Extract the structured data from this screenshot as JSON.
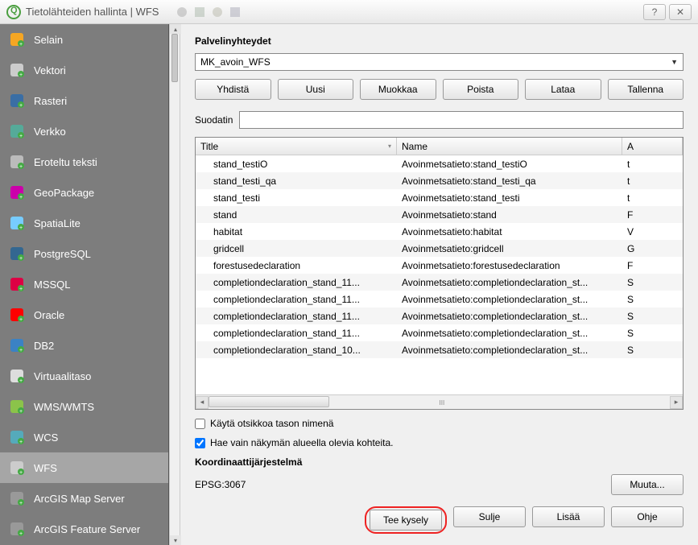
{
  "title": "Tietolähteiden hallinta | WFS",
  "sidebar": {
    "items": [
      {
        "label": "Selain",
        "icon": "folder",
        "color": "#f5a623"
      },
      {
        "label": "Vektori",
        "icon": "vector",
        "color": "#ccc"
      },
      {
        "label": "Rasteri",
        "icon": "raster",
        "color": "#3a6ea5"
      },
      {
        "label": "Verkko",
        "icon": "mesh",
        "color": "#5a9"
      },
      {
        "label": "Eroteltu teksti",
        "icon": "text",
        "color": "#bbb"
      },
      {
        "label": "GeoPackage",
        "icon": "gpkg",
        "color": "#c0a"
      },
      {
        "label": "SpatiaLite",
        "icon": "spatialite",
        "color": "#7cf"
      },
      {
        "label": "PostgreSQL",
        "icon": "postgres",
        "color": "#336791"
      },
      {
        "label": "MSSQL",
        "icon": "mssql",
        "color": "#d04"
      },
      {
        "label": "Oracle",
        "icon": "oracle",
        "color": "#f00"
      },
      {
        "label": "DB2",
        "icon": "db2",
        "color": "#3b82c4"
      },
      {
        "label": "Virtuaalitaso",
        "icon": "virtual",
        "color": "#ddd"
      },
      {
        "label": "WMS/WMTS",
        "icon": "wms",
        "color": "#8bc34a"
      },
      {
        "label": "WCS",
        "icon": "wcs",
        "color": "#5ab"
      },
      {
        "label": "WFS",
        "icon": "wfs",
        "color": "#ccc",
        "active": true
      },
      {
        "label": "ArcGIS Map Server",
        "icon": "arcmap",
        "color": "#999"
      },
      {
        "label": "ArcGIS Feature Server",
        "icon": "arcfeat",
        "color": "#999"
      }
    ]
  },
  "panel": {
    "connections_header": "Palvelinyhteydet",
    "combo_value": "MK_avoin_WFS",
    "buttons": {
      "connect": "Yhdistä",
      "new": "Uusi",
      "edit": "Muokkaa",
      "remove": "Poista",
      "load": "Lataa",
      "save": "Tallenna"
    },
    "filter_label": "Suodatin",
    "filter_value": "",
    "table": {
      "headers": {
        "title": "Title",
        "name": "Name",
        "abstract": "A"
      },
      "rows": [
        {
          "title": "stand_testiO",
          "name": "Avoinmetsatieto:stand_testiO",
          "a": "t"
        },
        {
          "title": "stand_testi_qa",
          "name": "Avoinmetsatieto:stand_testi_qa",
          "a": "t"
        },
        {
          "title": "stand_testi",
          "name": "Avoinmetsatieto:stand_testi",
          "a": "t"
        },
        {
          "title": "stand",
          "name": "Avoinmetsatieto:stand",
          "a": "F"
        },
        {
          "title": "habitat",
          "name": "Avoinmetsatieto:habitat",
          "a": "V"
        },
        {
          "title": "gridcell",
          "name": "Avoinmetsatieto:gridcell",
          "a": "G"
        },
        {
          "title": "forestusedeclaration",
          "name": "Avoinmetsatieto:forestusedeclaration",
          "a": "F"
        },
        {
          "title": "completiondeclaration_stand_11...",
          "name": "Avoinmetsatieto:completiondeclaration_st...",
          "a": "S"
        },
        {
          "title": "completiondeclaration_stand_11...",
          "name": "Avoinmetsatieto:completiondeclaration_st...",
          "a": "S"
        },
        {
          "title": "completiondeclaration_stand_11...",
          "name": "Avoinmetsatieto:completiondeclaration_st...",
          "a": "S"
        },
        {
          "title": "completiondeclaration_stand_11...",
          "name": "Avoinmetsatieto:completiondeclaration_st...",
          "a": "S"
        },
        {
          "title": "completiondeclaration_stand_10...",
          "name": "Avoinmetsatieto:completiondeclaration_st...",
          "a": "S"
        }
      ]
    },
    "chk_title": "Käytä otsikkoa tason nimenä",
    "chk_bbox": "Hae vain näkymän alueella olevia kohteita.",
    "crs_header": "Koordinaattijärjestelmä",
    "crs_code": "EPSG:3067",
    "btn_change": "Muuta...",
    "bottom": {
      "query": "Tee kysely",
      "close": "Sulje",
      "add": "Lisää",
      "help": "Ohje"
    }
  }
}
